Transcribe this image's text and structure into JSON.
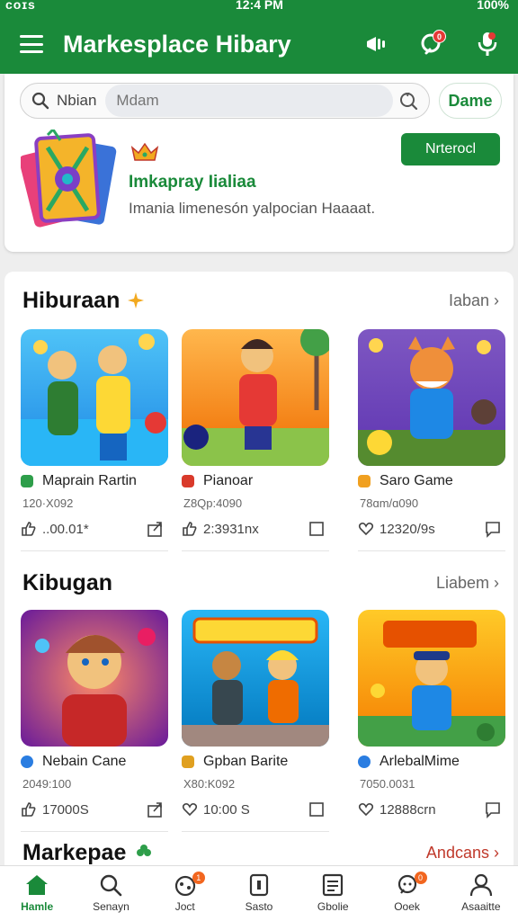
{
  "status_bar": {
    "left": "ᴄᴏɪs",
    "time": "12:4 PM",
    "battery": "100%"
  },
  "app": {
    "title": "Markesplace Hibary"
  },
  "appbar_icons": {
    "notify_badge": "0"
  },
  "search": {
    "label": "Nbian",
    "placeholder": "Mdam",
    "action": "Dame"
  },
  "promo": {
    "title": "Imkapray Iialiaa",
    "subtitle": "Imania limenesón yalpocian Haaaat.",
    "button": "Nrterocl"
  },
  "sections": [
    {
      "title": "Hiburaan",
      "more": "Iaban",
      "items": [
        {
          "name": "Maprain Rartin",
          "meta": "120·X092",
          "stat": "..00.01*",
          "icon_color": "#2e9e4a"
        },
        {
          "name": "Pianoar",
          "meta": "Z8Qp:4090",
          "stat": "2:3931nx",
          "icon_color": "#d93a2b"
        },
        {
          "name": "Saro Game",
          "meta": "78ɑm/ɑ090",
          "stat": "12320/9s",
          "icon_color": "#f0a020"
        }
      ]
    },
    {
      "title": "Kibugan",
      "more": "Liabem",
      "items": [
        {
          "name": "Nebain Cane",
          "meta": "2049:100",
          "stat": "17000S",
          "icon_color": "#2a7de1"
        },
        {
          "name": "Gpban Barite",
          "meta": "X80:K092",
          "stat": "10:00 S",
          "icon_color": "#e0a020"
        },
        {
          "name": "ArlebalMime",
          "meta": "7050.0031",
          "stat": "12888crn",
          "icon_color": "#2a7de1"
        }
      ]
    },
    {
      "title": "Markepae",
      "more": "Andcans",
      "items": []
    }
  ],
  "bottom_nav": [
    {
      "label": "Hamle",
      "icon": "home-icon",
      "active": true
    },
    {
      "label": "Senayn",
      "icon": "search-icon"
    },
    {
      "label": "Joct",
      "icon": "joystick-icon",
      "badge": "1"
    },
    {
      "label": "Sasto",
      "icon": "store-icon"
    },
    {
      "label": "Gbolie",
      "icon": "list-icon"
    },
    {
      "label": "Ooek",
      "icon": "chat-icon",
      "badge": "0"
    },
    {
      "label": "Asaaitte",
      "icon": "profile-icon"
    }
  ],
  "colors": {
    "primary": "#1a8a3a",
    "accent_red": "#c0392b",
    "badge": "#f2661f"
  }
}
